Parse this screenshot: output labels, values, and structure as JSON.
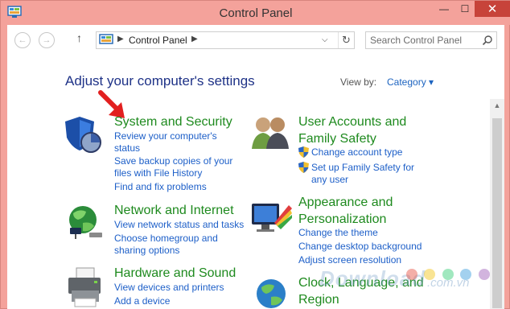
{
  "window": {
    "title": "Control Panel",
    "minimize": "—",
    "maximize": "☐",
    "close": "✕"
  },
  "nav": {
    "back": "←",
    "forward": "→",
    "up": "↑",
    "address_chevron": "▶",
    "address_text": "Control Panel",
    "dropdown": "⌵",
    "refresh": "↻"
  },
  "search": {
    "placeholder": "Search Control Panel"
  },
  "content": {
    "heading": "Adjust your computer's settings",
    "view_by_label": "View by:",
    "view_by_value": "Category ▾"
  },
  "categories": [
    {
      "title": "System and Security",
      "icon": "system-security-icon",
      "links": [
        "Review your computer's",
        "status",
        "Save backup copies of your",
        "files with File History",
        "Find and fix problems"
      ]
    },
    {
      "title": "Network and Internet",
      "icon": "network-globe-icon",
      "links": [
        "View network status and tasks",
        "Choose homegroup and",
        "sharing options"
      ]
    },
    {
      "title": "Hardware and Sound",
      "icon": "printer-icon",
      "links": [
        "View devices and printers",
        "Add a device"
      ]
    },
    {
      "title_line1": "User Accounts and",
      "title_line2": "Family Safety",
      "icon": "users-icon",
      "links": [
        "Change account type",
        "Set up Family Safety for",
        "any user"
      ]
    },
    {
      "title_line1": "Appearance and",
      "title_line2": "Personalization",
      "icon": "monitor-palette-icon",
      "links": [
        "Change the theme",
        "Change desktop background",
        "Adjust screen resolution"
      ]
    },
    {
      "title_line1": "Clock, Language, and",
      "title_line2": "Region",
      "icon": "clock-globe-icon"
    }
  ],
  "watermark": {
    "text": "Download",
    "suffix": ".com.vn"
  },
  "colors": {
    "title_bar": "#f4a29b",
    "close_button": "#c7433a",
    "heading": "#1e3287",
    "category_title": "#1e8a1e",
    "link": "#1d5fc8"
  }
}
